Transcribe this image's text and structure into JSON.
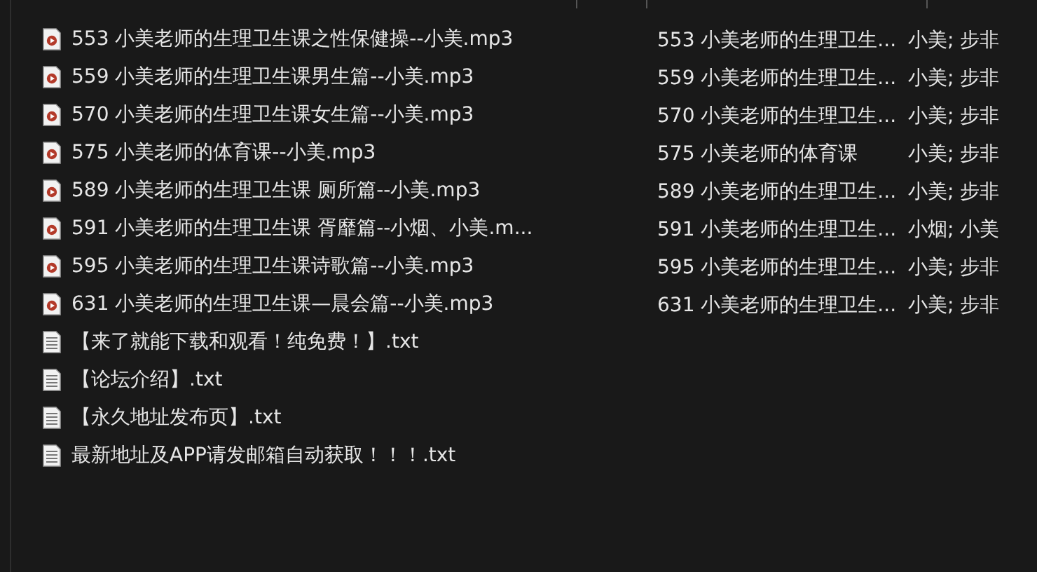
{
  "files": [
    {
      "kind": "audio",
      "name": "553 小美老师的生理卫生课之性保健操--小美.mp3",
      "title": "553 小美老师的生理卫生...",
      "artist": "小美; 步非"
    },
    {
      "kind": "audio",
      "name": "559 小美老师的生理卫生课男生篇--小美.mp3",
      "title": "559 小美老师的生理卫生...",
      "artist": "小美; 步非"
    },
    {
      "kind": "audio",
      "name": "570 小美老师的生理卫生课女生篇--小美.mp3",
      "title": "570 小美老师的生理卫生...",
      "artist": "小美; 步非"
    },
    {
      "kind": "audio",
      "name": "575 小美老师的体育课--小美.mp3",
      "title": "575 小美老师的体育课",
      "artist": "小美; 步非"
    },
    {
      "kind": "audio",
      "name": "589 小美老师的生理卫生课 厕所篇--小美.mp3",
      "title": "589 小美老师的生理卫生...",
      "artist": "小美; 步非"
    },
    {
      "kind": "audio",
      "name": "591 小美老师的生理卫生课 胥靡篇--小烟、小美.m...",
      "title": "591 小美老师的生理卫生...",
      "artist": "小烟; 小美"
    },
    {
      "kind": "audio",
      "name": "595 小美老师的生理卫生课诗歌篇--小美.mp3",
      "title": "595 小美老师的生理卫生...",
      "artist": "小美; 步非"
    },
    {
      "kind": "audio",
      "name": "631 小美老师的生理卫生课—晨会篇--小美.mp3",
      "title": "631 小美老师的生理卫生...",
      "artist": "小美; 步非"
    },
    {
      "kind": "text",
      "name": "【来了就能下载和观看！纯免费！】.txt"
    },
    {
      "kind": "text",
      "name": "【论坛介绍】.txt"
    },
    {
      "kind": "text",
      "name": "【永久地址发布页】.txt"
    },
    {
      "kind": "text",
      "name": "最新地址及APP请发邮箱自动获取！！！.txt"
    }
  ]
}
